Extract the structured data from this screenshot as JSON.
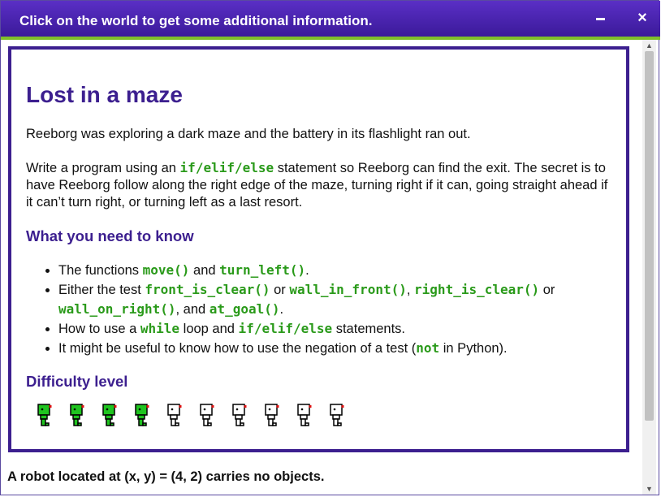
{
  "window": {
    "title": "Click on the world to get some additional information.",
    "minimize_label": "",
    "close_label": "×"
  },
  "content": {
    "heading": "Lost in a maze",
    "intro": "Reeborg was exploring a dark maze and the battery in its flashlight ran out.",
    "p2": {
      "before": "Write a program using an ",
      "code": "if/elif/else",
      "after": " statement so Reeborg can find the exit. The secret is to have Reeborg follow along the right edge of the maze, turning right if it can, going straight ahead if it can’t turn right, or turning left as a last resort."
    },
    "need_heading": "What you need to know",
    "bullets": {
      "b1": {
        "t1": "The functions ",
        "c1": "move()",
        "t2": " and ",
        "c2": "turn_left()",
        "t3": "."
      },
      "b2": {
        "t1": "Either the test ",
        "c1": "front_is_clear()",
        "t2": " or ",
        "c2": "wall_in_front()",
        "t3": ", ",
        "c3": "right_is_clear()",
        "t4": " or ",
        "c4": "wall_on_right()",
        "t5": ", and ",
        "c5": "at_goal()",
        "t6": "."
      },
      "b3": {
        "t1": "How to use a ",
        "c1": "while",
        "t2": " loop and ",
        "c2": "if/elif/else",
        "t3": " statements."
      },
      "b4": {
        "t1": "It might be useful to know how to use the negation of a test (",
        "c1": "not",
        "t2": " in Python)."
      }
    },
    "difficulty_heading": "Difficulty level",
    "difficulty": {
      "level": 4,
      "max": 10,
      "filled_color": "#1fc41f",
      "empty_color": "#ffffff"
    }
  },
  "status": "A robot located at (x, y) = (4, 2) carries no objects.",
  "colors": {
    "title_bg": "#4a26b0",
    "accent_green": "#7fbf2a",
    "heading": "#3c1f8f",
    "code": "#2a9a1a"
  }
}
